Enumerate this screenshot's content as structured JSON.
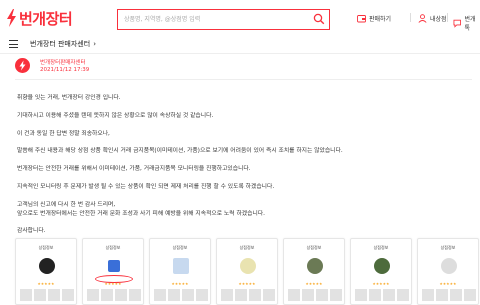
{
  "header": {
    "logo_text": "번개장터",
    "search_placeholder": "상품명, 지역명, @상점명 입력",
    "links": [
      {
        "label": "판매하기",
        "icon": "wallet-icon"
      },
      {
        "label": "내상점",
        "icon": "user-icon"
      },
      {
        "label": "번개톡",
        "icon": "chat-icon"
      }
    ],
    "brand_color": "#f9303c"
  },
  "subnav": {
    "breadcrumb": "번개장터 판매자센터",
    "chevron": "›"
  },
  "post": {
    "author": "번개장터판매자센터",
    "date": "2021/11/12 17:39",
    "paragraphs": [
      "취향을 잇는 거래, 번개장터 강인경 입니다.",
      "기대하시고 이용해 주셨을 텐데 뜻하지 않은 상황으로 많이 속상하실 것 같습니다.",
      "이 건과 동일 한 답변 정말 죄송하오나,",
      "말씀해 주신 내용과 해당 상점 상품 확인시 거래 금지품목(이미테이션, 가품)으로 보기에 어려움이 있어 즉시 조치를 하지는 않았습니다.",
      "번개장터는 안전한 거래를 위해서 이미테이션, 가품, 거래금지품목 모니터링을 진행하고있습니다.",
      "지속적인 모니터링 후 문제가 발생 될 수 있는 상품이 확인 되면 제재 처리를 진행 할 수 있도록 하겠습니다.",
      "고객님의 신고에 다시 한 번 감사 드리며,",
      "앞으로도 번개장터에서는 안전한 거래 문화 조성과 사기 피해 예방을 위해 지속적으로 노력 하겠습니다.",
      "감사합니다."
    ]
  },
  "cards": [
    {
      "title": "상점정보",
      "name": "",
      "stars": "★★★★★",
      "logo_color": "#222222"
    },
    {
      "title": "상점정보",
      "name": "",
      "stars": "★★★★★",
      "logo_color": "#3a6fd8"
    },
    {
      "title": "상점정보",
      "name": "",
      "stars": "★★★★★",
      "logo_color": "#c7d9ef"
    },
    {
      "title": "상점정보",
      "name": "",
      "stars": "★★★★★",
      "logo_color": "#e9e3b0"
    },
    {
      "title": "상점정보",
      "name": "",
      "stars": "★★★★★",
      "logo_color": "#6b7a55"
    },
    {
      "title": "상점정보",
      "name": "",
      "stars": "★★★★★",
      "logo_color": "#4d6b3c"
    },
    {
      "title": "상점정보",
      "name": "",
      "stars": "★★★★★",
      "logo_color": "#dddddd"
    }
  ]
}
